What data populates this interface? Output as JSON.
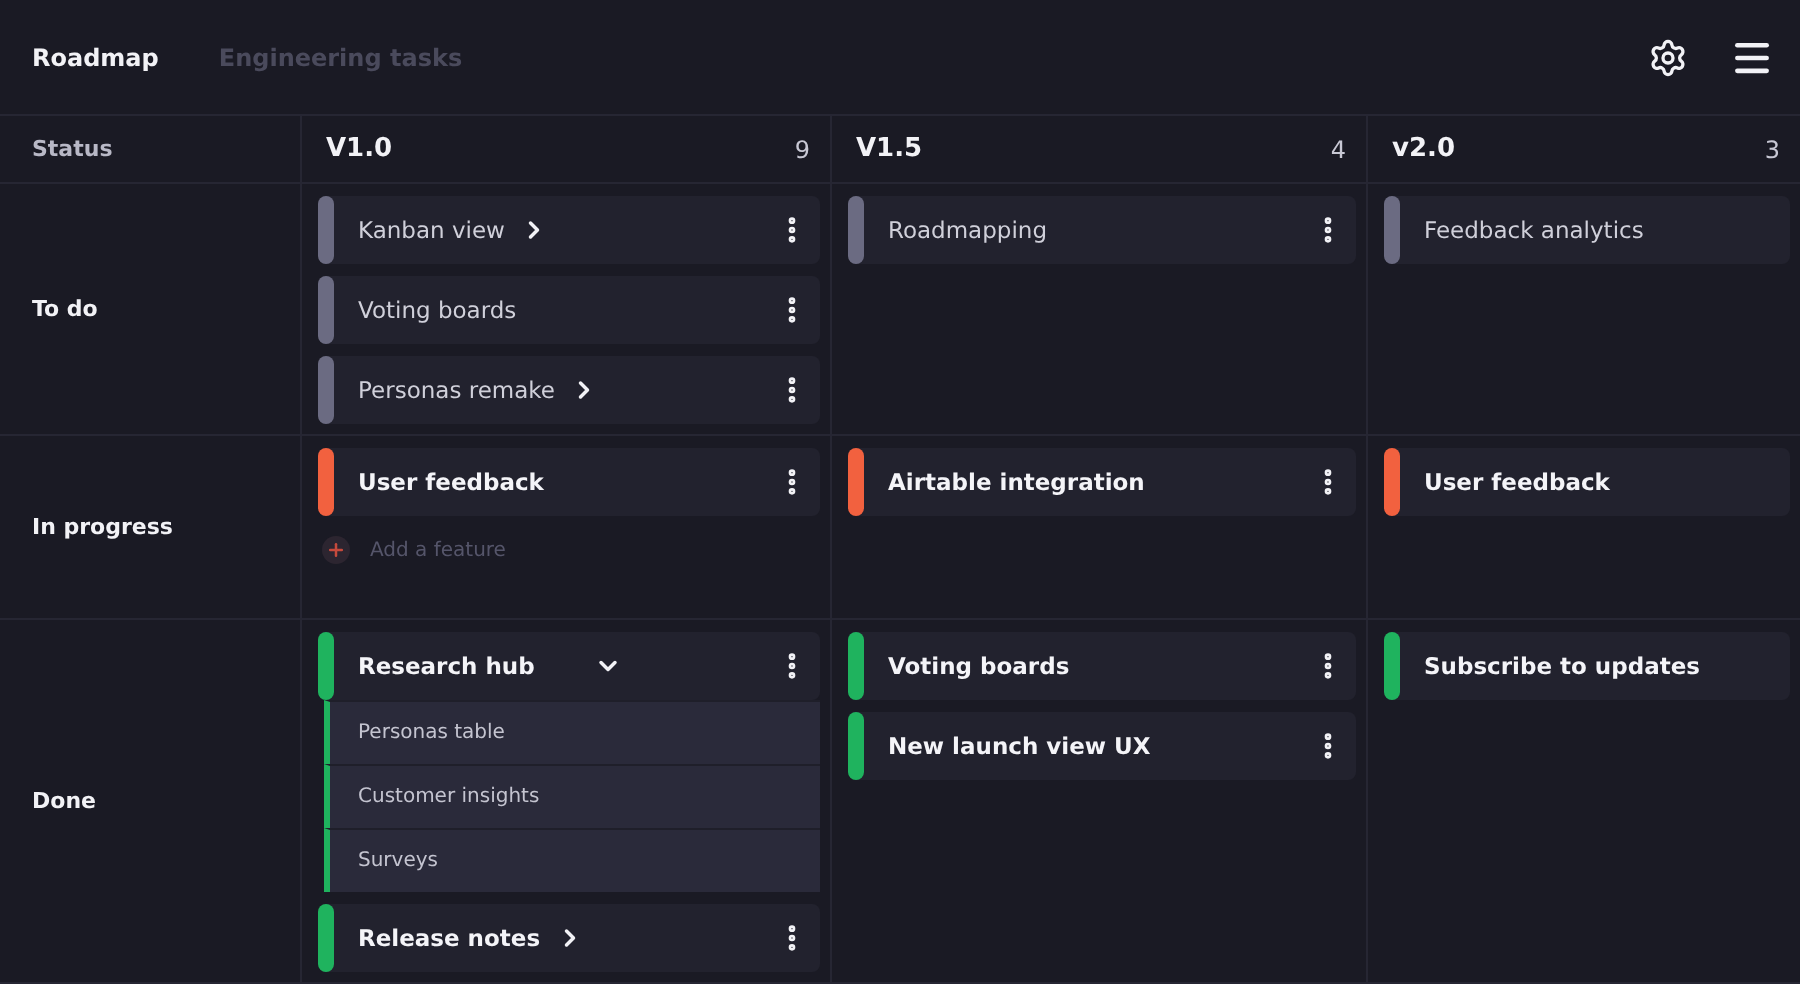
{
  "tabs": [
    {
      "label": "Roadmap",
      "selected": true
    },
    {
      "label": "Engineering tasks",
      "selected": false
    }
  ],
  "status_header": "Status",
  "columns": [
    {
      "title": "V1.0",
      "count": "9"
    },
    {
      "title": "V1.5",
      "count": "4"
    },
    {
      "title": "v2.0",
      "count": "3"
    }
  ],
  "rows": [
    {
      "label": "To do",
      "kind": "planned",
      "color": "#6b6b82",
      "cells": [
        {
          "cards": [
            {
              "title": "Kanban view",
              "expanded": false,
              "menu": true
            },
            {
              "title": "Voting boards",
              "menu": true
            },
            {
              "title": "Personas remake",
              "expanded": false,
              "menu": true
            }
          ]
        },
        {
          "cards": [
            {
              "title": "Roadmapping",
              "menu": true
            }
          ]
        },
        {
          "cards": [
            {
              "title": "Feedback analytics",
              "menu": false
            }
          ]
        }
      ]
    },
    {
      "label": "In progress",
      "kind": "active",
      "color": "#f2613f",
      "cells": [
        {
          "cards": [
            {
              "title": "User feedback",
              "menu": true
            }
          ],
          "add_label": "Add a feature"
        },
        {
          "cards": [
            {
              "title": "Airtable integration",
              "menu": true
            }
          ]
        },
        {
          "cards": [
            {
              "title": "User feedback",
              "menu": false
            }
          ]
        }
      ]
    },
    {
      "label": "Done",
      "kind": "finished",
      "color": "#1fb35e",
      "cells": [
        {
          "cards": [
            {
              "title": "Research hub",
              "expanded": true,
              "menu": true,
              "children": [
                {
                  "title": "Personas table"
                },
                {
                  "title": "Customer insights"
                },
                {
                  "title": "Surveys"
                }
              ]
            },
            {
              "title": "Release notes",
              "expanded": false,
              "menu": true
            }
          ]
        },
        {
          "cards": [
            {
              "title": "Voting boards",
              "menu": true
            },
            {
              "title": "New launch view UX",
              "menu": true
            }
          ]
        },
        {
          "cards": [
            {
              "title": "Subscribe to updates",
              "menu": false
            }
          ]
        }
      ]
    }
  ]
}
